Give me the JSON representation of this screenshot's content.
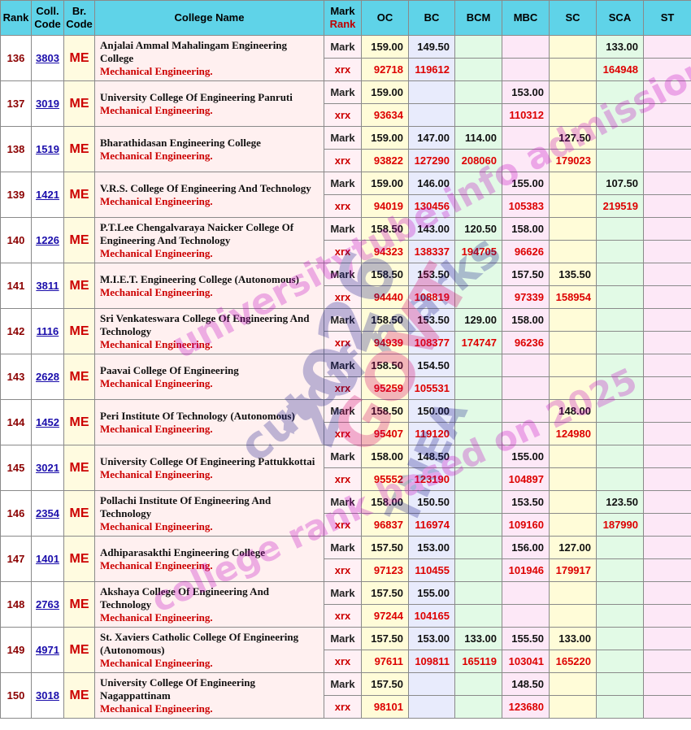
{
  "headers": {
    "rank": "Rank",
    "coll_code": "Coll. Code",
    "br_code": "Br. Code",
    "college_name": "College Name",
    "mark": "Mark",
    "rank_sub": "Rank",
    "oc": "OC",
    "bc": "BC",
    "bcm": "BCM",
    "mbc": "MBC",
    "sc": "SC",
    "sca": "SCA",
    "st": "ST"
  },
  "labels": {
    "mark": "Mark",
    "xrx": "xrx"
  },
  "watermark": {
    "line1": "universitytube.info admission",
    "line2": "cutoff marks",
    "line3": "2026",
    "line4": "GOVT",
    "line5": "TNEA",
    "line6": "college rank based on 2025"
  },
  "rows": [
    {
      "rank": "136",
      "code": "3803",
      "br": "ME",
      "name": "Anjalai Ammal Mahalingam Engineering College",
      "branch": "Mechanical Engineering.",
      "mark": {
        "oc": "159.00",
        "bc": "149.50",
        "bcm": "",
        "mbc": "",
        "sc": "",
        "sca": "133.00",
        "st": ""
      },
      "xrx": {
        "oc": "92718",
        "bc": "119612",
        "bcm": "",
        "mbc": "",
        "sc": "",
        "sca": "164948",
        "st": ""
      }
    },
    {
      "rank": "137",
      "code": "3019",
      "br": "ME",
      "name": "University College Of Engineering Panruti",
      "branch": "Mechanical Engineering.",
      "mark": {
        "oc": "159.00",
        "bc": "",
        "bcm": "",
        "mbc": "153.00",
        "sc": "",
        "sca": "",
        "st": ""
      },
      "xrx": {
        "oc": "93634",
        "bc": "",
        "bcm": "",
        "mbc": "110312",
        "sc": "",
        "sca": "",
        "st": ""
      }
    },
    {
      "rank": "138",
      "code": "1519",
      "br": "ME",
      "name": "Bharathidasan Engineering College",
      "branch": "Mechanical Engineering.",
      "mark": {
        "oc": "159.00",
        "bc": "147.00",
        "bcm": "114.00",
        "mbc": "",
        "sc": "127.50",
        "sca": "",
        "st": ""
      },
      "xrx": {
        "oc": "93822",
        "bc": "127290",
        "bcm": "208060",
        "mbc": "",
        "sc": "179023",
        "sca": "",
        "st": ""
      }
    },
    {
      "rank": "139",
      "code": "1421",
      "br": "ME",
      "name": "V.R.S. College Of Engineering And Technology",
      "branch": "Mechanical Engineering.",
      "mark": {
        "oc": "159.00",
        "bc": "146.00",
        "bcm": "",
        "mbc": "155.00",
        "sc": "",
        "sca": "107.50",
        "st": ""
      },
      "xrx": {
        "oc": "94019",
        "bc": "130456",
        "bcm": "",
        "mbc": "105383",
        "sc": "",
        "sca": "219519",
        "st": ""
      }
    },
    {
      "rank": "140",
      "code": "1226",
      "br": "ME",
      "name": "P.T.Lee Chengalvaraya Naicker College Of Engineering And Technology",
      "branch": "Mechanical Engineering.",
      "mark": {
        "oc": "158.50",
        "bc": "143.00",
        "bcm": "120.50",
        "mbc": "158.00",
        "sc": "",
        "sca": "",
        "st": ""
      },
      "xrx": {
        "oc": "94323",
        "bc": "138337",
        "bcm": "194705",
        "mbc": "96626",
        "sc": "",
        "sca": "",
        "st": ""
      }
    },
    {
      "rank": "141",
      "code": "3811",
      "br": "ME",
      "name": "M.I.E.T. Engineering College (Autonomous)",
      "branch": "Mechanical Engineering.",
      "mark": {
        "oc": "158.50",
        "bc": "153.50",
        "bcm": "",
        "mbc": "157.50",
        "sc": "135.50",
        "sca": "",
        "st": ""
      },
      "xrx": {
        "oc": "94440",
        "bc": "108819",
        "bcm": "",
        "mbc": "97339",
        "sc": "158954",
        "sca": "",
        "st": ""
      }
    },
    {
      "rank": "142",
      "code": "1116",
      "br": "ME",
      "name": "Sri Venkateswara College Of Engineering And Technology",
      "branch": "Mechanical Engineering.",
      "mark": {
        "oc": "158.50",
        "bc": "153.50",
        "bcm": "129.00",
        "mbc": "158.00",
        "sc": "",
        "sca": "",
        "st": ""
      },
      "xrx": {
        "oc": "94939",
        "bc": "108377",
        "bcm": "174747",
        "mbc": "96236",
        "sc": "",
        "sca": "",
        "st": ""
      }
    },
    {
      "rank": "143",
      "code": "2628",
      "br": "ME",
      "name": "Paavai College Of Engineering",
      "branch": "Mechanical Engineering.",
      "mark": {
        "oc": "158.50",
        "bc": "154.50",
        "bcm": "",
        "mbc": "",
        "sc": "",
        "sca": "",
        "st": ""
      },
      "xrx": {
        "oc": "95259",
        "bc": "105531",
        "bcm": "",
        "mbc": "",
        "sc": "",
        "sca": "",
        "st": ""
      }
    },
    {
      "rank": "144",
      "code": "1452",
      "br": "ME",
      "name": "Peri Institute Of Technology (Autonomous)",
      "branch": "Mechanical Engineering.",
      "mark": {
        "oc": "158.50",
        "bc": "150.00",
        "bcm": "",
        "mbc": "",
        "sc": "148.00",
        "sca": "",
        "st": ""
      },
      "xrx": {
        "oc": "95407",
        "bc": "119120",
        "bcm": "",
        "mbc": "",
        "sc": "124980",
        "sca": "",
        "st": ""
      }
    },
    {
      "rank": "145",
      "code": "3021",
      "br": "ME",
      "name": "University College Of Engineering Pattukkottai",
      "branch": "Mechanical Engineering.",
      "mark": {
        "oc": "158.00",
        "bc": "148.50",
        "bcm": "",
        "mbc": "155.00",
        "sc": "",
        "sca": "",
        "st": ""
      },
      "xrx": {
        "oc": "95552",
        "bc": "123190",
        "bcm": "",
        "mbc": "104897",
        "sc": "",
        "sca": "",
        "st": ""
      }
    },
    {
      "rank": "146",
      "code": "2354",
      "br": "ME",
      "name": "Pollachi Institute Of Engineering And Technology",
      "branch": "Mechanical Engineering.",
      "mark": {
        "oc": "158.00",
        "bc": "150.50",
        "bcm": "",
        "mbc": "153.50",
        "sc": "",
        "sca": "123.50",
        "st": ""
      },
      "xrx": {
        "oc": "96837",
        "bc": "116974",
        "bcm": "",
        "mbc": "109160",
        "sc": "",
        "sca": "187990",
        "st": ""
      }
    },
    {
      "rank": "147",
      "code": "1401",
      "br": "ME",
      "name": "Adhiparasakthi Engineering College",
      "branch": "Mechanical Engineering.",
      "mark": {
        "oc": "157.50",
        "bc": "153.00",
        "bcm": "",
        "mbc": "156.00",
        "sc": "127.00",
        "sca": "",
        "st": ""
      },
      "xrx": {
        "oc": "97123",
        "bc": "110455",
        "bcm": "",
        "mbc": "101946",
        "sc": "179917",
        "sca": "",
        "st": ""
      }
    },
    {
      "rank": "148",
      "code": "2763",
      "br": "ME",
      "name": "Akshaya College Of Engineering And Technology",
      "branch": "Mechanical Engineering.",
      "mark": {
        "oc": "157.50",
        "bc": "155.00",
        "bcm": "",
        "mbc": "",
        "sc": "",
        "sca": "",
        "st": ""
      },
      "xrx": {
        "oc": "97244",
        "bc": "104165",
        "bcm": "",
        "mbc": "",
        "sc": "",
        "sca": "",
        "st": ""
      }
    },
    {
      "rank": "149",
      "code": "4971",
      "br": "ME",
      "name": "St. Xaviers Catholic College Of Engineering (Autonomous)",
      "branch": "Mechanical Engineering.",
      "mark": {
        "oc": "157.50",
        "bc": "153.00",
        "bcm": "133.00",
        "mbc": "155.50",
        "sc": "133.00",
        "sca": "",
        "st": ""
      },
      "xrx": {
        "oc": "97611",
        "bc": "109811",
        "bcm": "165119",
        "mbc": "103041",
        "sc": "165220",
        "sca": "",
        "st": ""
      }
    },
    {
      "rank": "150",
      "code": "3018",
      "br": "ME",
      "name": "University College Of Engineering Nagappattinam",
      "branch": "Mechanical Engineering.",
      "mark": {
        "oc": "157.50",
        "bc": "",
        "bcm": "",
        "mbc": "148.50",
        "sc": "",
        "sca": "",
        "st": ""
      },
      "xrx": {
        "oc": "98101",
        "bc": "",
        "bcm": "",
        "mbc": "123680",
        "sc": "",
        "sca": "",
        "st": ""
      }
    }
  ]
}
